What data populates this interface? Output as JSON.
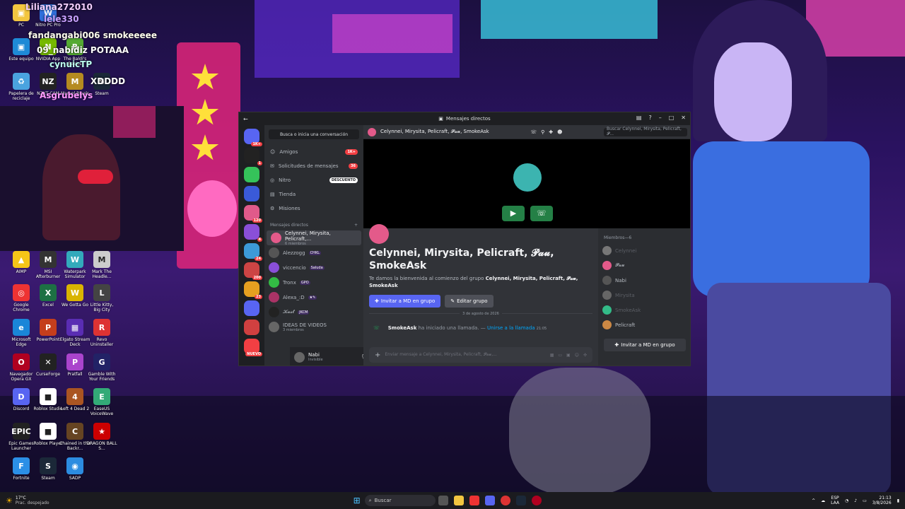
{
  "desktop": {
    "icons": [
      {
        "label": "PC",
        "color": "#f3c640",
        "glyph": "▣"
      },
      {
        "label": "Nitro PC Pro",
        "color": "#2f6fdb",
        "glyph": "W"
      },
      {
        "label": "Este equipo",
        "color": "#1e8ad6",
        "glyph": "▣"
      },
      {
        "label": "NVIDIA App",
        "color": "#76b900",
        "glyph": "N"
      },
      {
        "label": "The Baldi's Basics",
        "color": "#5a3",
        "glyph": "B"
      },
      {
        "label": "Papelera de reciclaje",
        "color": "#4aa3df",
        "glyph": "♻"
      },
      {
        "label": "NZXT CAM",
        "color": "#222",
        "glyph": "NZ"
      },
      {
        "label": "Marvel Rivals",
        "color": "#b58b20",
        "glyph": "M"
      },
      {
        "label": "Steam",
        "color": "#1b2838",
        "glyph": "S"
      },
      {
        "label": "AIMP",
        "color": "#f5c518",
        "glyph": "▲"
      },
      {
        "label": "MSI Afterburner",
        "color": "#333",
        "glyph": "M"
      },
      {
        "label": "Waterpark Simulator",
        "color": "#3ab",
        "glyph": "W"
      },
      {
        "label": "Mark The Headle...",
        "color": "#ccc",
        "glyph": "M"
      },
      {
        "label": "Google Chrome",
        "color": "#e33",
        "glyph": "◎"
      },
      {
        "label": "Excel",
        "color": "#1d7044",
        "glyph": "X"
      },
      {
        "label": "We Gotta Go",
        "color": "#d9b400",
        "glyph": "W"
      },
      {
        "label": "Little Kitty, Big City",
        "color": "#444",
        "glyph": "L"
      },
      {
        "label": "Microsoft Edge",
        "color": "#1a86d8",
        "glyph": "e"
      },
      {
        "label": "PowerPoint",
        "color": "#c43e1c",
        "glyph": "P"
      },
      {
        "label": "Elgato Stream Deck",
        "color": "#5a2db3",
        "glyph": "▦"
      },
      {
        "label": "Revo Uninstaller",
        "color": "#d33",
        "glyph": "R"
      },
      {
        "label": "Navegador Opera GX",
        "color": "#b00020",
        "glyph": "O"
      },
      {
        "label": "CurseForge",
        "color": "#222",
        "glyph": "✕"
      },
      {
        "label": "Pratfall",
        "color": "#a4c",
        "glyph": "P"
      },
      {
        "label": "Gamble With Your Friends",
        "color": "#226",
        "glyph": "G"
      },
      {
        "label": "Discord",
        "color": "#5865f2",
        "glyph": "D"
      },
      {
        "label": "Roblox Studio",
        "color": "#fff",
        "glyph": "■"
      },
      {
        "label": "Left 4 Dead 2",
        "color": "#a52",
        "glyph": "4"
      },
      {
        "label": "EaseUS VoiceWave",
        "color": "#3a7",
        "glyph": "E"
      },
      {
        "label": "Epic Games Launcher",
        "color": "#222",
        "glyph": "EPIC"
      },
      {
        "label": "Roblox Player",
        "color": "#fff",
        "glyph": "■"
      },
      {
        "label": "Chained in the Backr...",
        "color": "#642",
        "glyph": "C"
      },
      {
        "label": "DRAGON BALL S...",
        "color": "#c00",
        "glyph": "★"
      },
      {
        "label": "Fortnite",
        "color": "#2b8fe6",
        "glyph": "F"
      },
      {
        "label": "Steam",
        "color": "#1b2838",
        "glyph": "S"
      },
      {
        "label": "SADP",
        "color": "#2c8ce0",
        "glyph": "◉"
      }
    ],
    "chat_overlay": [
      {
        "text": "Liliana272010",
        "color": "#f5d0ff"
      },
      {
        "text": "lele330",
        "color": "#c8a0ff"
      },
      {
        "text": "fandangabi006 smokeeeee",
        "color": "#ffe"
      },
      {
        "text": "09_nabidiz POTAAA",
        "color": "#fff"
      },
      {
        "text": "cynuicTP",
        "color": "#bfe"
      },
      {
        "text": "XDDDD",
        "color": "#fff"
      },
      {
        "text": "Asgrubelys",
        "color": "#f9f"
      }
    ]
  },
  "discord": {
    "window_title": "Mensajes directos",
    "servers": [
      {
        "color": "#5865f2",
        "badge": "1K+"
      },
      {
        "color": "#222",
        "badge": "1"
      },
      {
        "color": "#35c35a",
        "badge": ""
      },
      {
        "color": "#3a5ad8",
        "badge": ""
      },
      {
        "color": "#e05a8a",
        "badge": "120"
      },
      {
        "color": "#8a4fd8",
        "badge": "4"
      },
      {
        "color": "#3c9ad8",
        "badge": "24"
      },
      {
        "color": "#c44",
        "badge": "200"
      },
      {
        "color": "#e6a020",
        "badge": "23"
      },
      {
        "color": "#5865f2",
        "badge": ""
      },
      {
        "color": "#d04040",
        "badge": ""
      },
      {
        "color": "#f23f43",
        "badge": "NUEVO"
      }
    ],
    "search_btn": "Busca o inicia una conversación",
    "nav": [
      {
        "label": "Amigos",
        "icon": "friends-icon",
        "pill": "1K+"
      },
      {
        "label": "Solicitudes de mensajes",
        "icon": "mail-icon",
        "pill": "36"
      },
      {
        "label": "Nitro",
        "icon": "nitro-icon",
        "tag": "DESCUENTO"
      },
      {
        "label": "Tienda",
        "icon": "shop-icon"
      },
      {
        "label": "Misiones",
        "icon": "quests-icon"
      }
    ],
    "dm_header": "Mensajes directos",
    "dms": [
      {
        "name": "Celynnei, Mirysita, Pelicraft,...",
        "sub": "6 miembros",
        "active": true,
        "color": "#e35a8a"
      },
      {
        "name": "Alezzogg",
        "tag": "CHKL",
        "color": "#555"
      },
      {
        "name": "viccencio",
        "tag": "Saluda",
        "color": "#8a4fd8"
      },
      {
        "name": "Tronx",
        "tag": "GPO",
        "color": "#3b4"
      },
      {
        "name": "Alexa_:D",
        "tag": "★✎",
        "color": "#a36"
      },
      {
        "name": "𝓚𝓪𝓼𝓽",
        "tag": "JKCM",
        "color": "#222"
      },
      {
        "name": "IDEAS DE VIDEOS",
        "sub": "3 miembros",
        "color": "#666"
      }
    ],
    "user": {
      "name": "Nabi",
      "status": "Invisible"
    },
    "channel_title": "Celynnei, Mirysita, Pelicraft, 𝓟𝓪𝓾, SmokeAsk",
    "search_placeholder": "Buscar Celynnei, Mirysita, Pelicraft, 𝓟...",
    "welcome_title": "Celynnei, Mirysita, Pelicraft, 𝓟𝓪𝓾, SmokeAsk",
    "welcome_text_pre": "Te damos la bienvenida al comienzo del grupo ",
    "welcome_text_names": "Celynnei, Mirysita, Pelicraft, 𝓟𝓪𝓾, SmokeAsk",
    "invite_btn": "Invitar a MD en grupo",
    "edit_btn": "Editar grupo",
    "date_divider": "3 de agosto de 2026",
    "call_msg": {
      "user": "SmokeAsk",
      "text": " ha iniciado una llamada. — ",
      "link": "Unirse a la llamada",
      "time": "21:05"
    },
    "msg_placeholder": "Enviar mensaje a Celynnei, Mirysita, Pelicraft, 𝓟𝓪𝓾,...",
    "members_header": "Miembros—6",
    "members": [
      {
        "name": "Celynnei",
        "color": "#777",
        "dim": true
      },
      {
        "name": "𝓟𝓪𝓾",
        "color": "#e35a8a",
        "dim": false
      },
      {
        "name": "Nabi",
        "color": "#555",
        "dim": false
      },
      {
        "name": "Mirysita",
        "color": "#666",
        "dim": true
      },
      {
        "name": "SmokeAsk",
        "color": "#3b8",
        "dim": true
      },
      {
        "name": "Pelicraft",
        "color": "#c84",
        "dim": false
      }
    ],
    "members_invite": "Invitar a MD en grupo"
  },
  "taskbar": {
    "weather_temp": "17°C",
    "weather_desc": "Prac. despejado",
    "search": "Buscar",
    "lang": "ESP",
    "lang2": "LAA",
    "time": "21:13",
    "date": "3/8/2026"
  }
}
